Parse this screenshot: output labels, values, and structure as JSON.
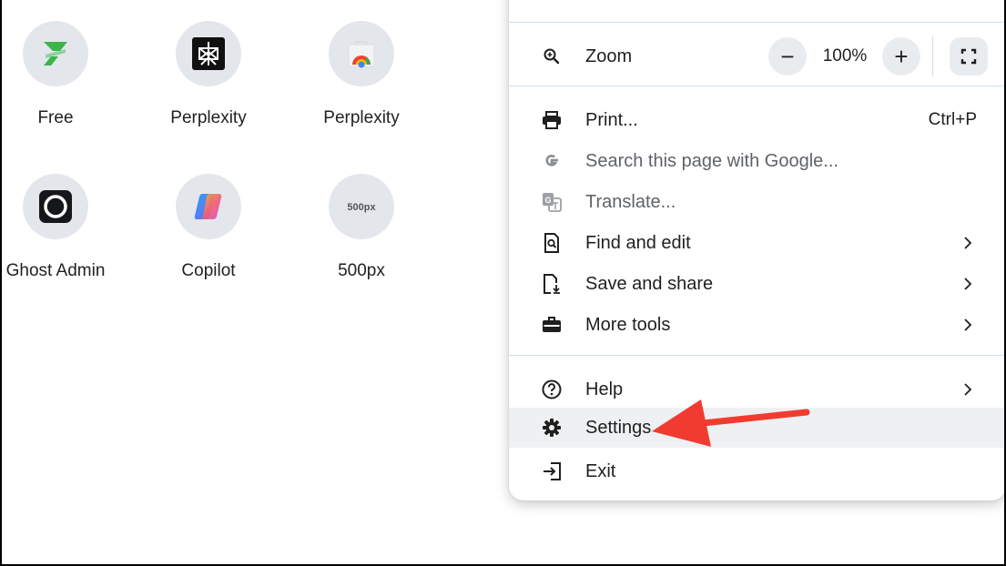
{
  "shortcuts": [
    {
      "label": "Free",
      "icon": "zap-logo-icon"
    },
    {
      "label": "Perplexity",
      "icon": "perplexity-logo-icon"
    },
    {
      "label": "Perplexity",
      "icon": "chrome-store-logo-icon"
    },
    {
      "label": "Ghost Admin",
      "icon": "ghost-logo-icon"
    },
    {
      "label": "Copilot",
      "icon": "copilot-logo-icon"
    },
    {
      "label": "500px",
      "icon": "500px-logo-icon",
      "logo_text": "500px"
    }
  ],
  "menu": {
    "zoom": {
      "label": "Zoom",
      "value": "100%",
      "minus": "−",
      "plus": "+"
    },
    "print": {
      "label": "Print...",
      "shortcut": "Ctrl+P"
    },
    "search_google": {
      "label": "Search this page with Google..."
    },
    "translate": {
      "label": "Translate..."
    },
    "find_edit": {
      "label": "Find and edit"
    },
    "save_share": {
      "label": "Save and share"
    },
    "more_tools": {
      "label": "More tools"
    },
    "help": {
      "label": "Help"
    },
    "settings": {
      "label": "Settings"
    },
    "exit": {
      "label": "Exit"
    }
  },
  "colors": {
    "accent_arrow": "#f23b30",
    "highlight": "#eef0f2",
    "tile_bg": "#e3e7ec"
  }
}
